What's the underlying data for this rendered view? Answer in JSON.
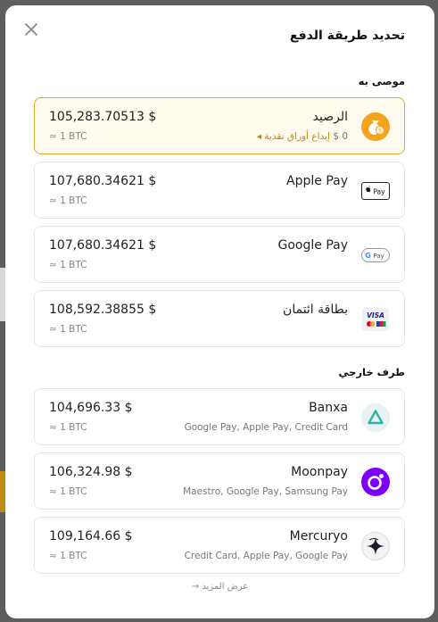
{
  "modal": {
    "title": "تحديد طريقة الدفع"
  },
  "sections": {
    "recommended": "موصى به",
    "external": "طرف خارجي"
  },
  "recommended": [
    {
      "name": "الرصيد",
      "amount": "105,283.70513 $",
      "btc": "≈ 1 BTC",
      "sub_value": "0 $",
      "sub_action": "إيداع أوراق نقدية ◂",
      "icon": "money-bag-icon",
      "selected": true
    },
    {
      "name": "Apple Pay",
      "amount": "107,680.34621 $",
      "btc": "≈ 1 BTC",
      "icon": "apple-pay-icon"
    },
    {
      "name": "Google Pay",
      "amount": "107,680.34621 $",
      "btc": "≈ 1 BTC",
      "icon": "google-pay-icon"
    },
    {
      "name": "بطاقة ائتمان",
      "amount": "108,592.38855 $",
      "btc": "≈ 1 BTC",
      "icon": "credit-card-icon"
    }
  ],
  "external": [
    {
      "name": "Banxa",
      "amount": "104,696.33 $",
      "btc": "≈ 1 BTC",
      "methods": "Google Pay, Apple Pay, Credit Card",
      "icon": "banxa-logo-icon"
    },
    {
      "name": "Moonpay",
      "amount": "106,324.98 $",
      "btc": "≈ 1 BTC",
      "methods": "...rd, Maestro, Google Pay, Samsung Pay",
      "icon": "moonpay-logo-icon"
    },
    {
      "name": "Mercuryo",
      "amount": "109,164.66 $",
      "btc": "≈ 1 BTC",
      "methods": "...PA, Credit Card, Apple Pay, Google Pay",
      "icon": "mercuryo-logo-icon"
    }
  ],
  "show_more": "عرض المزيد →",
  "colors": {
    "accent": "#f2a41c",
    "selected_border": "#e3aa2c",
    "moonpay": "#7d00ff",
    "banxa": "#2bb4a8"
  }
}
